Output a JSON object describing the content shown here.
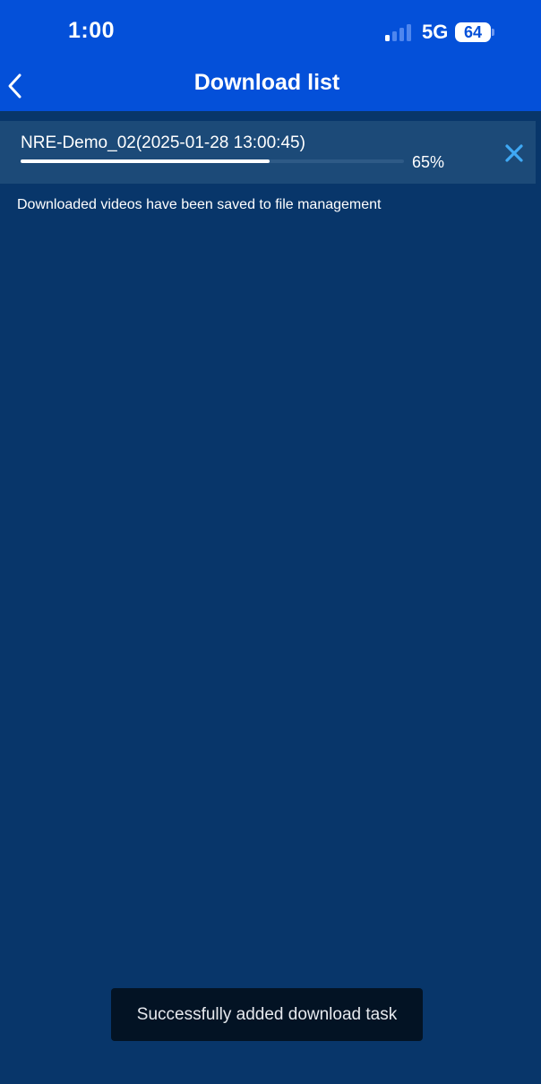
{
  "status_bar": {
    "time": "1:00",
    "network": "5G",
    "battery": "64",
    "signal_bars_active": 1
  },
  "nav": {
    "title": "Download list",
    "back_icon": "chevron-left-icon"
  },
  "downloads": [
    {
      "name": "NRE-Demo_02(2025-01-28 13:00:45)",
      "progress_text": "65%",
      "progress_fraction": 0.65,
      "cancel_icon": "close-icon"
    }
  ],
  "info_text": "Downloaded videos have been saved to file management",
  "toast": {
    "message": "Successfully added download task"
  },
  "colors": {
    "header": "#0450d9",
    "background": "#08366a",
    "item_background": "#1c4a78",
    "accent_close": "#3fa9f5",
    "toast_background": "#031324"
  }
}
